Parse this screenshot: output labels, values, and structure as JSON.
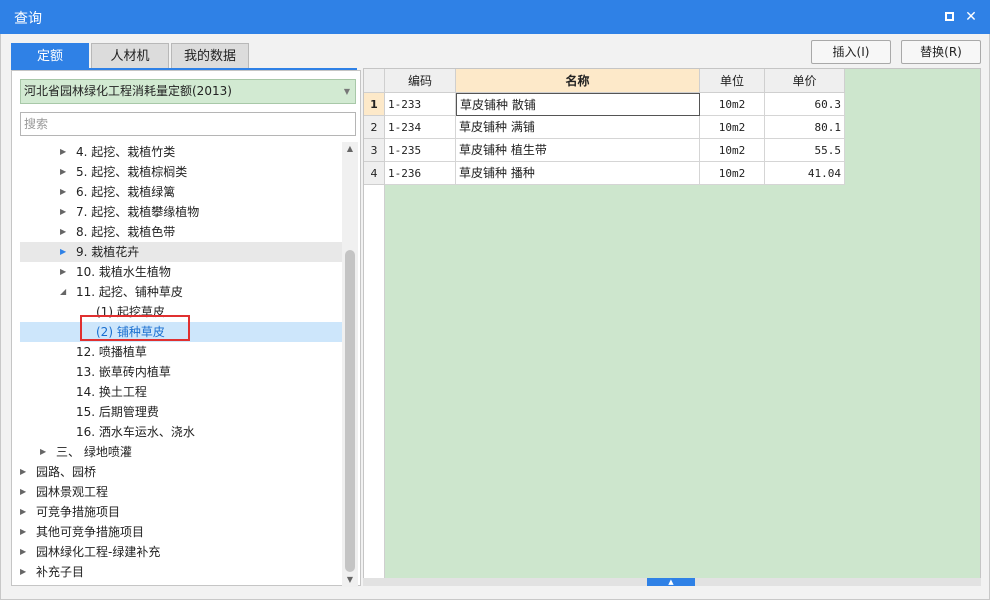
{
  "window": {
    "title": "查询"
  },
  "tabs": [
    {
      "label": "定额",
      "active": true
    },
    {
      "label": "人材机",
      "active": false
    },
    {
      "label": "我的数据",
      "active": false
    }
  ],
  "toolbar": {
    "insert_label": "插入(I)",
    "replace_label": "替换(R)"
  },
  "library": {
    "selected": "河北省园林绿化工程消耗量定额(2013)"
  },
  "search": {
    "placeholder": "搜索",
    "value": ""
  },
  "tree": [
    {
      "label": "4. 起挖、栽植竹类",
      "level": 2,
      "expander": "collapsed"
    },
    {
      "label": "5. 起挖、栽植棕榈类",
      "level": 2,
      "expander": "collapsed"
    },
    {
      "label": "6. 起挖、栽植绿篱",
      "level": 2,
      "expander": "collapsed"
    },
    {
      "label": "7. 起挖、栽植攀缘植物",
      "level": 2,
      "expander": "collapsed"
    },
    {
      "label": "8. 起挖、栽植色带",
      "level": 2,
      "expander": "collapsed"
    },
    {
      "label": "9. 栽植花卉",
      "level": 2,
      "expander": "collapsed-blue",
      "hover": true
    },
    {
      "label": "10. 栽植水生植物",
      "level": 2,
      "expander": "collapsed"
    },
    {
      "label": "11. 起挖、铺种草皮",
      "level": 2,
      "expander": "expanded"
    },
    {
      "label": "(1) 起挖草皮",
      "level": 3,
      "expander": "none"
    },
    {
      "label": "(2) 铺种草皮",
      "level": 3,
      "expander": "none",
      "selected": true
    },
    {
      "label": "12. 喷播植草",
      "level": 2,
      "expander": "none"
    },
    {
      "label": "13. 嵌草砖内植草",
      "level": 2,
      "expander": "none"
    },
    {
      "label": "14. 换土工程",
      "level": 2,
      "expander": "none"
    },
    {
      "label": "15. 后期管理费",
      "level": 2,
      "expander": "none"
    },
    {
      "label": "16. 洒水车运水、浇水",
      "level": 2,
      "expander": "none"
    },
    {
      "label": "三、 绿地喷灌",
      "level": 1,
      "expander": "collapsed"
    },
    {
      "label": "园路、园桥",
      "level": 0,
      "expander": "collapsed"
    },
    {
      "label": "园林景观工程",
      "level": 0,
      "expander": "collapsed"
    },
    {
      "label": "可竞争措施项目",
      "level": 0,
      "expander": "collapsed"
    },
    {
      "label": "其他可竞争措施项目",
      "level": 0,
      "expander": "collapsed"
    },
    {
      "label": "园林绿化工程-绿建补充",
      "level": 0,
      "expander": "collapsed"
    },
    {
      "label": "补充子目",
      "level": 0,
      "expander": "collapsed"
    }
  ],
  "table": {
    "columns": [
      "编码",
      "名称",
      "单位",
      "单价"
    ],
    "rows": [
      {
        "num": "1",
        "code": "1-233",
        "name": "草皮铺种 散铺",
        "unit": "10m2",
        "price": "60.3"
      },
      {
        "num": "2",
        "code": "1-234",
        "name": "草皮铺种 满铺",
        "unit": "10m2",
        "price": "80.1"
      },
      {
        "num": "3",
        "code": "1-235",
        "name": "草皮铺种 植生带",
        "unit": "10m2",
        "price": "55.5"
      },
      {
        "num": "4",
        "code": "1-236",
        "name": "草皮铺种 播种",
        "unit": "10m2",
        "price": "41.04"
      }
    ]
  },
  "colors": {
    "accent": "#2f81e6",
    "selection": "#cde6fb",
    "grid_bg": "#cde6cd",
    "highlight": "#e03030"
  }
}
